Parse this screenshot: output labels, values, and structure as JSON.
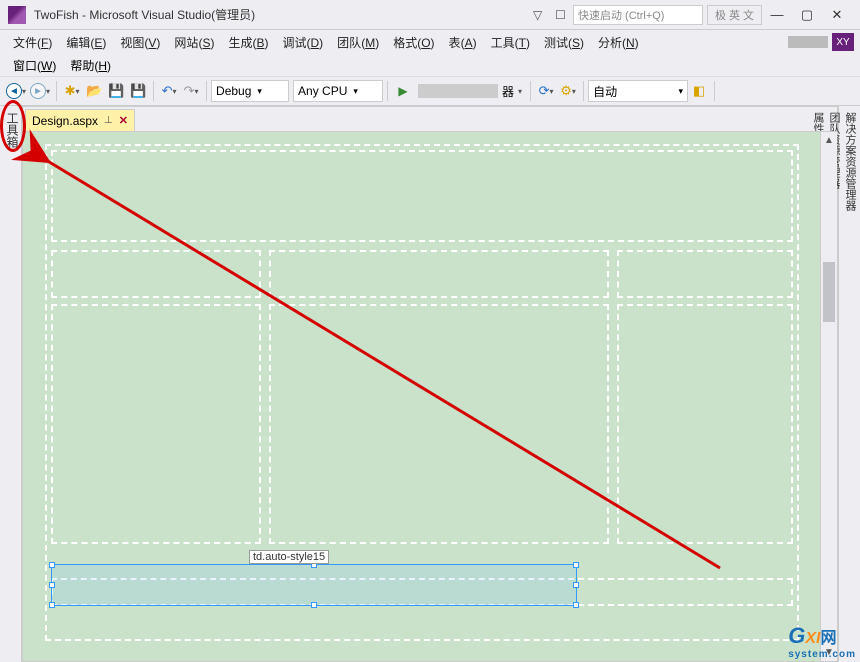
{
  "titlebar": {
    "title": "TwoFish - Microsoft Visual Studio(管理员)",
    "quick_launch_placeholder": "快速启动 (Ctrl+Q)",
    "ime_text": "极 英 文"
  },
  "menu": {
    "items": [
      {
        "label": "文件",
        "hotkey": "F"
      },
      {
        "label": "编辑",
        "hotkey": "E"
      },
      {
        "label": "视图",
        "hotkey": "V"
      },
      {
        "label": "网站",
        "hotkey": "S"
      },
      {
        "label": "生成",
        "hotkey": "B"
      },
      {
        "label": "调试",
        "hotkey": "D"
      },
      {
        "label": "团队",
        "hotkey": "M"
      },
      {
        "label": "格式",
        "hotkey": "O"
      },
      {
        "label": "表",
        "hotkey": "A"
      },
      {
        "label": "工具",
        "hotkey": "T"
      },
      {
        "label": "测试",
        "hotkey": "S"
      },
      {
        "label": "分析",
        "hotkey": "N"
      }
    ],
    "row2": [
      {
        "label": "窗口",
        "hotkey": "W"
      },
      {
        "label": "帮助",
        "hotkey": "H"
      }
    ],
    "user_badge": "XY"
  },
  "toolbar": {
    "config": "Debug",
    "platform": "Any CPU",
    "auto_dropdown": "自动",
    "browser_label": "器"
  },
  "tab": {
    "filename": "Design.aspx"
  },
  "left_rail": {
    "label": "工具箱"
  },
  "right_rail": {
    "items": [
      "解决方案资源管理器",
      "团队资源管理器",
      "属性"
    ]
  },
  "selection": {
    "tag_label": "td.auto-style15"
  },
  "watermark": {
    "g": "G",
    "xi": "XI",
    "net": "网",
    "domain": "system.com"
  }
}
